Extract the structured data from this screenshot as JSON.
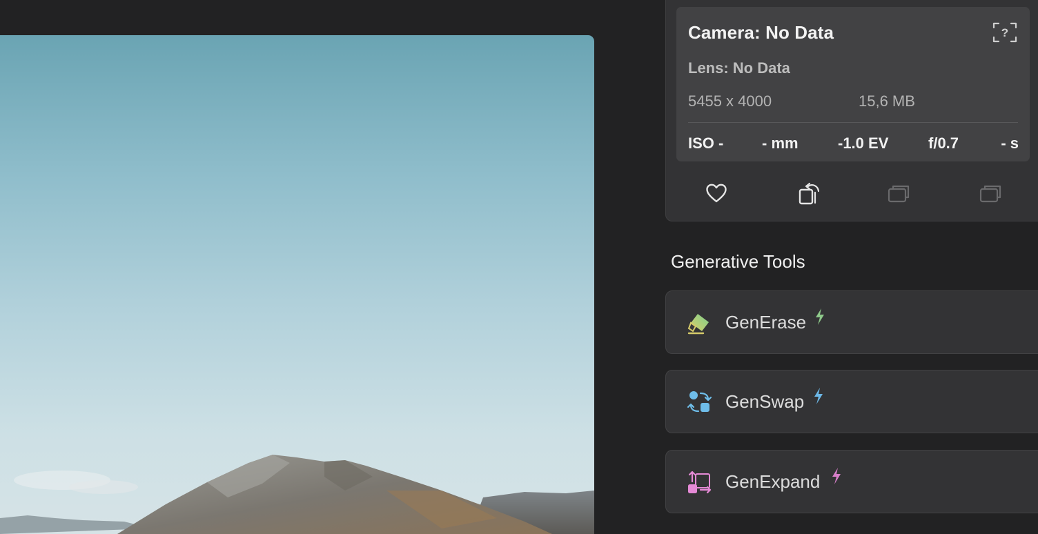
{
  "info": {
    "camera": "Camera: No Data",
    "lens": "Lens: No Data",
    "dimensions": "5455 x 4000",
    "file_size": "15,6 MB",
    "exif": {
      "iso": "ISO -",
      "focal_length": "- mm",
      "exposure": "-1.0 EV",
      "aperture": "f/0.7",
      "shutter": "- s"
    },
    "help_icon": "question-mark-box-icon",
    "actions": [
      {
        "name": "favorite",
        "icon": "heart-icon"
      },
      {
        "name": "rotate",
        "icon": "rotate-icon"
      },
      {
        "name": "stack-previous",
        "icon": "stacked-frames-icon"
      },
      {
        "name": "stack-next",
        "icon": "stacked-frames-icon"
      }
    ]
  },
  "generative_tools": {
    "title": "Generative Tools",
    "tools": [
      {
        "label": "GenErase",
        "icon": "eraser-icon",
        "bolt_color": "#8ec98a"
      },
      {
        "label": "GenSwap",
        "icon": "swap-icon",
        "bolt_color": "#6cb7e6"
      },
      {
        "label": "GenExpand",
        "icon": "expand-icon",
        "bolt_color": "#d77fc9"
      }
    ]
  }
}
